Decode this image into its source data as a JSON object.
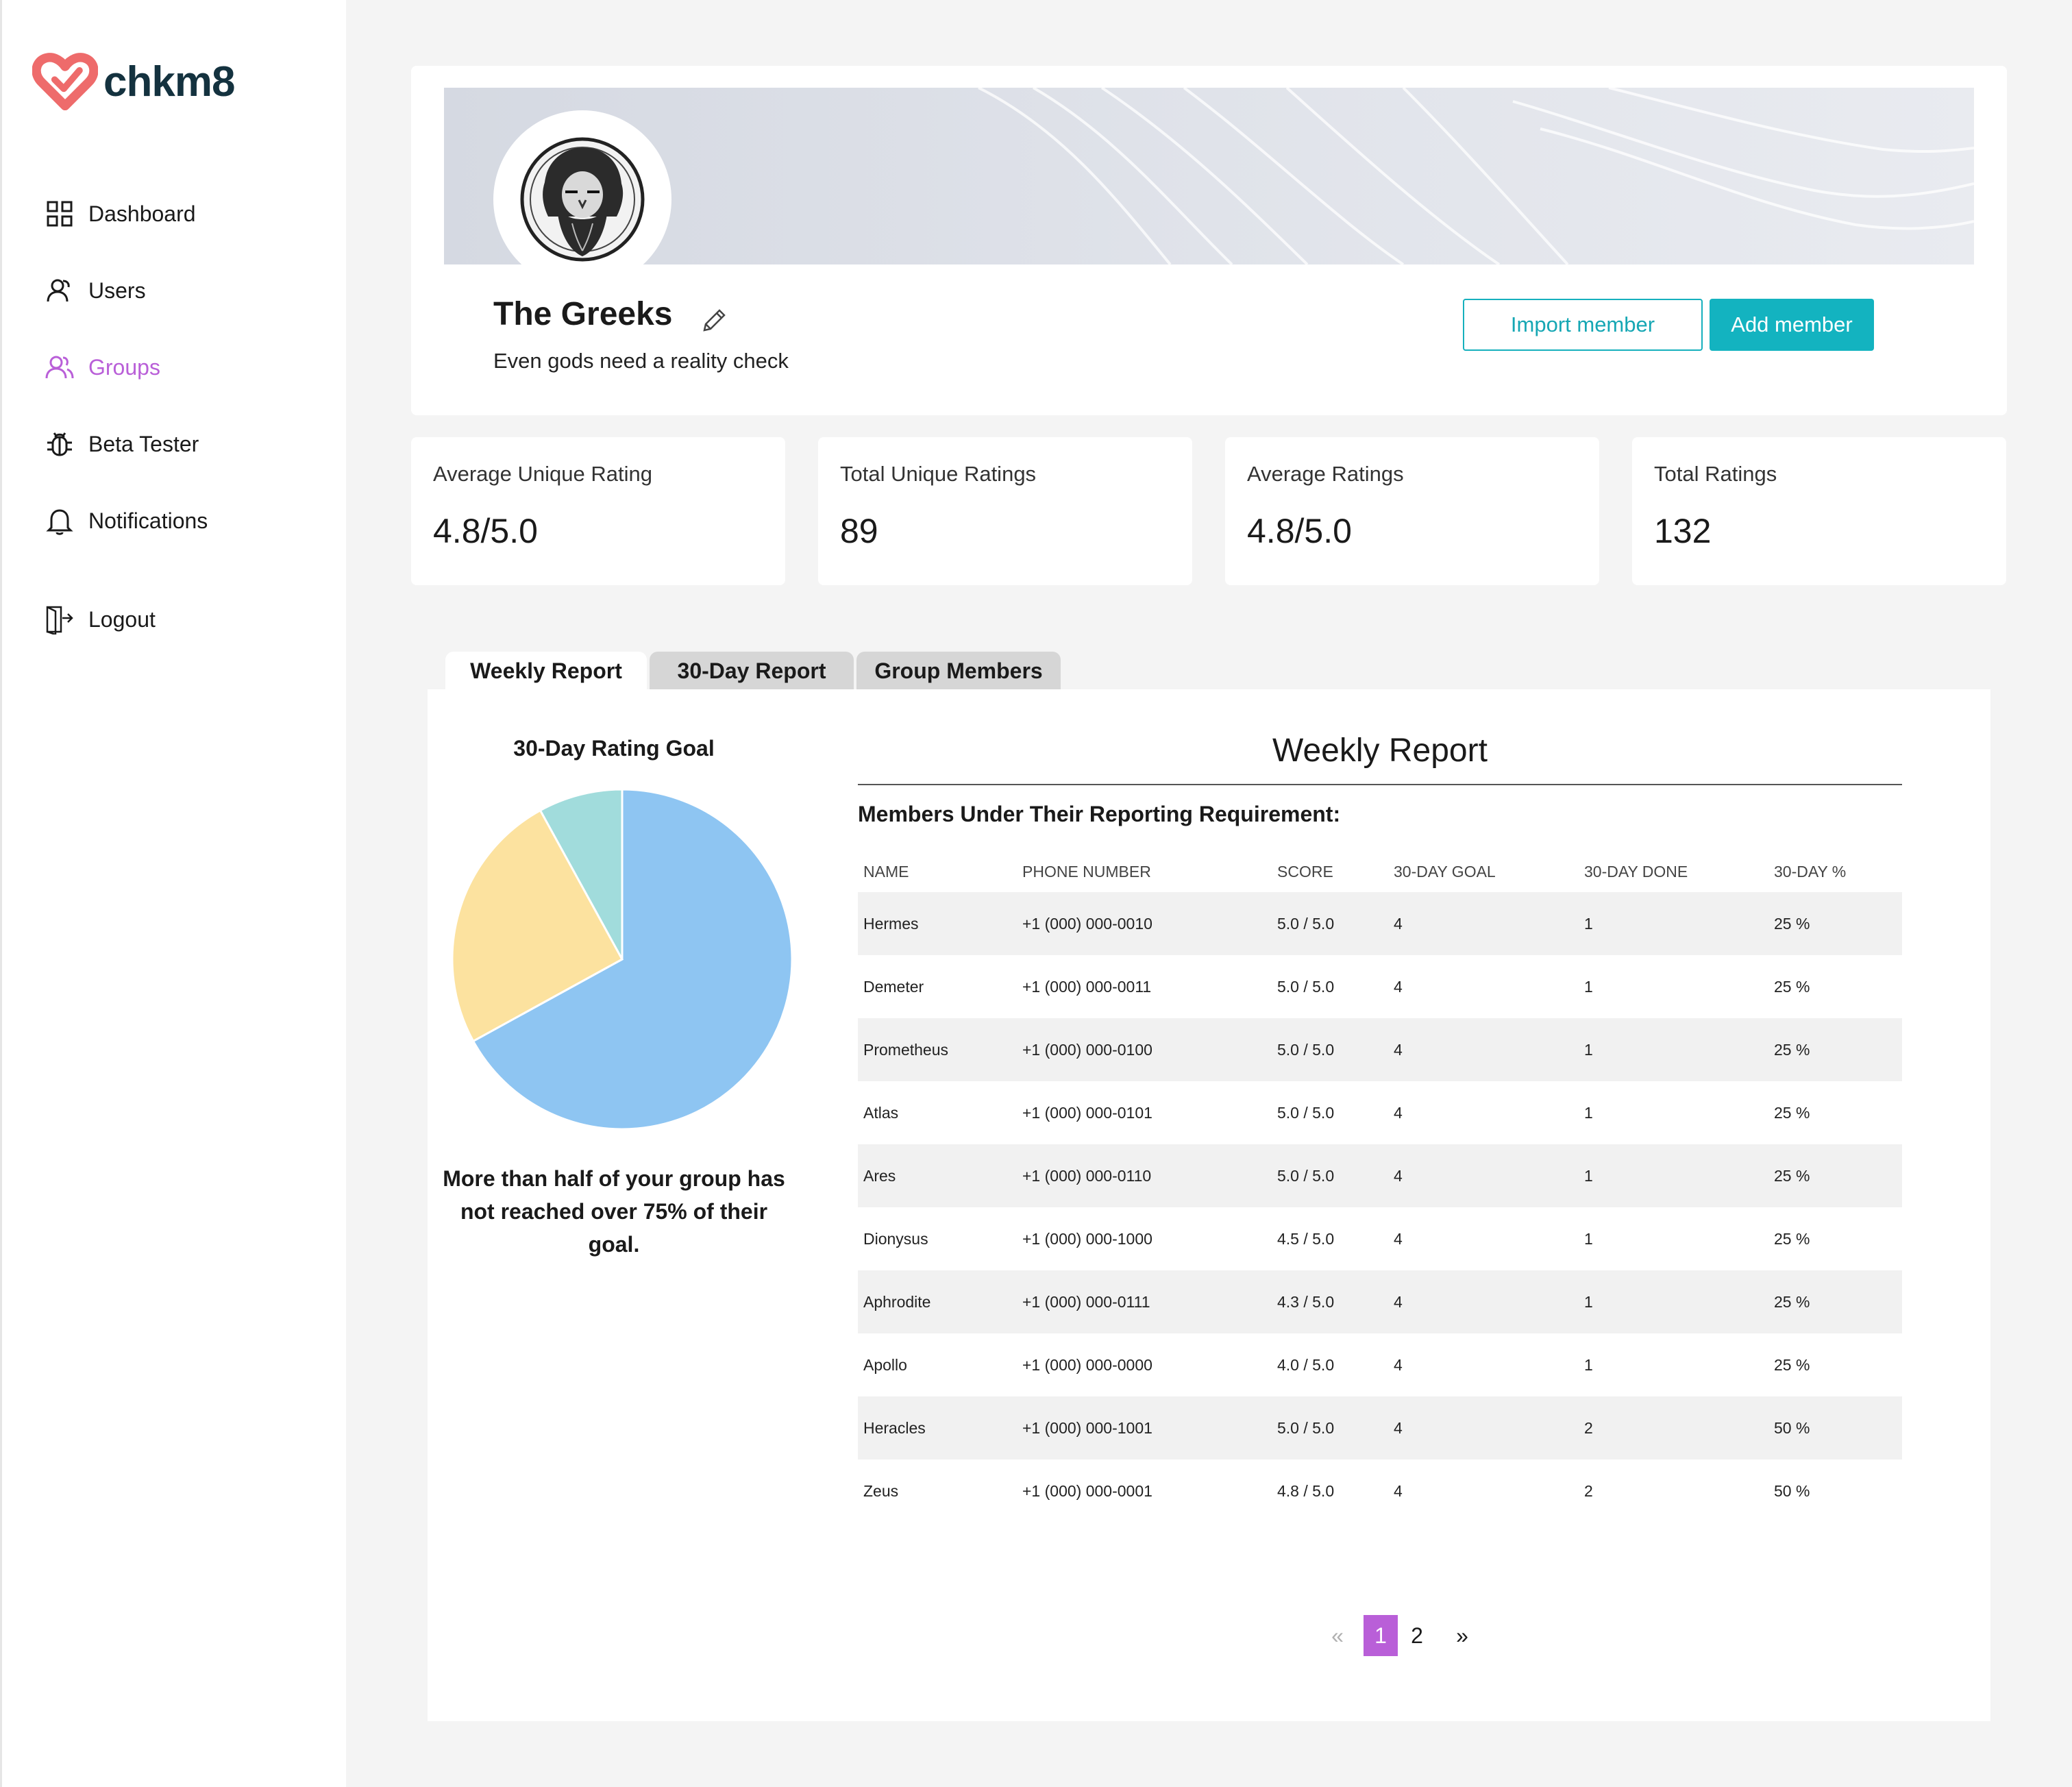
{
  "app": {
    "logo_text": "chkm8"
  },
  "sidebar": {
    "items": [
      {
        "label": "Dashboard",
        "icon": "grid-icon"
      },
      {
        "label": "Users",
        "icon": "user-icon"
      },
      {
        "label": "Groups",
        "icon": "users-icon",
        "active": true
      },
      {
        "label": "Beta Tester",
        "icon": "bug-icon"
      },
      {
        "label": "Notifications",
        "icon": "bell-icon"
      }
    ],
    "logout": "Logout"
  },
  "group": {
    "name": "The Greeks",
    "tagline": "Even gods need a reality check",
    "import_label": "Import member",
    "add_label": "Add member"
  },
  "stats": [
    {
      "label": "Average Unique Rating",
      "value": "4.8/5.0"
    },
    {
      "label": "Total Unique Ratings",
      "value": "89"
    },
    {
      "label": "Average Ratings",
      "value": "4.8/5.0"
    },
    {
      "label": "Total Ratings",
      "value": "132"
    }
  ],
  "tabs": [
    {
      "label": "Weekly Report",
      "active": true
    },
    {
      "label": "30-Day Report",
      "active": false
    },
    {
      "label": "Group Members",
      "active": false
    }
  ],
  "chart": {
    "title": "30-Day Rating Goal",
    "caption": "More than half of your group has not reached over 75% of their goal."
  },
  "chart_data": {
    "type": "pie",
    "title": "30-Day Rating Goal",
    "slices": [
      {
        "value": 67,
        "color": "#8ec5f2"
      },
      {
        "value": 25,
        "color": "#fce29f"
      },
      {
        "value": 8,
        "color": "#a1dcdc"
      }
    ]
  },
  "report": {
    "title": "Weekly Report",
    "subtitle": "Members Under Their Reporting Requirement:",
    "columns": [
      "NAME",
      "PHONE NUMBER",
      "SCORE",
      "30-DAY GOAL",
      "30-DAY DONE",
      "30-DAY %"
    ],
    "rows": [
      [
        "Hermes",
        "+1 (000) 000-0010",
        "5.0 / 5.0",
        "4",
        "1",
        "25 %"
      ],
      [
        "Demeter",
        "+1 (000) 000-0011",
        "5.0 / 5.0",
        "4",
        "1",
        "25 %"
      ],
      [
        "Prometheus",
        "+1 (000) 000-0100",
        "5.0 / 5.0",
        "4",
        "1",
        "25 %"
      ],
      [
        "Atlas",
        "+1 (000) 000-0101",
        "5.0 / 5.0",
        "4",
        "1",
        "25 %"
      ],
      [
        "Ares",
        "+1 (000) 000-0110",
        "5.0 / 5.0",
        "4",
        "1",
        "25 %"
      ],
      [
        "Dionysus",
        "+1 (000) 000-1000",
        "4.5 / 5.0",
        "4",
        "1",
        "25 %"
      ],
      [
        "Aphrodite",
        "+1 (000) 000-0111",
        "4.3 / 5.0",
        "4",
        "1",
        "25 %"
      ],
      [
        "Apollo",
        "+1 (000) 000-0000",
        "4.0 / 5.0",
        "4",
        "1",
        "25 %"
      ],
      [
        "Heracles",
        "+1 (000) 000-1001",
        "5.0 / 5.0",
        "4",
        "2",
        "50 %"
      ],
      [
        "Zeus",
        "+1 (000) 000-0001",
        "4.8 / 5.0",
        "4",
        "2",
        "50 %"
      ]
    ]
  },
  "pagination": {
    "prev": "«",
    "pages": [
      "1",
      "2"
    ],
    "current": "1",
    "next": "»"
  },
  "colors": {
    "accent": "#b95fd8",
    "primary": "#13b3c0",
    "brand": "#ee6b6b"
  }
}
